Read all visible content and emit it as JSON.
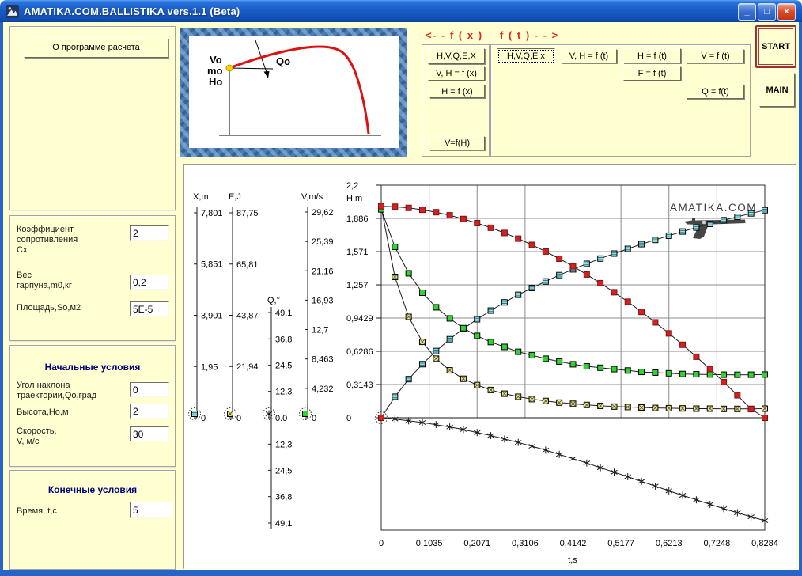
{
  "window": {
    "title": "AMATIKA.COM.BALLISTIKA vers.1.1 (Beta)",
    "minimize_glyph": "_",
    "maximize_glyph": "□",
    "close_glyph": "×"
  },
  "left": {
    "about_button": "О программе расчета",
    "params": {
      "cx_label": "Коэффициент\nсопротивления\nСх",
      "cx_value": "2",
      "m_label": "Вес\nгарпуна,m0,кг",
      "m_value": "0,2",
      "s_label": "Площадь,So,м2",
      "s_value": "5E-5"
    },
    "initial": {
      "title": "Начальные условия",
      "q_label": "Угол наклона\nтраектории,Qo,град",
      "q_value": "0",
      "h_label": "Высота,Но,м",
      "h_value": "2",
      "v_label": "Скорость,\nV, м/с",
      "v_value": "30"
    },
    "final": {
      "title": "Конечные условия",
      "t_label": "Время, t,c",
      "t_value": "5"
    }
  },
  "diagram": {
    "v_label": "Vo",
    "m_label": "mo",
    "h_label": "Ho",
    "q_label": "Qo"
  },
  "fx": {
    "title": "<- - f ( x )",
    "buttons": [
      "H,V,Q,E,X",
      "V, H = f (x)",
      "H = f (x)",
      "V=f(H)"
    ]
  },
  "ft": {
    "title": "f ( t ) - - >",
    "active_button": "H,V,Q,E x",
    "buttons": [
      "V, H = f (t)",
      "H = f (t)",
      "V = f (t)",
      "F = f (t)",
      "Q = f(t)"
    ]
  },
  "actions": {
    "start": "START",
    "main": "MAIN"
  },
  "chart_data": {
    "type": "line",
    "title_watermark": "AMATIKA.COM",
    "xlabel": "t,s",
    "x_range": [
      0,
      0.8284
    ],
    "x_tick_labels": [
      "0",
      "0,1035",
      "0,2071",
      "0,3106",
      "0,4142",
      "0,5177",
      "0,6213",
      "0,7248",
      "0,8284"
    ],
    "grid": true,
    "x": [
      0,
      0.0296,
      0.0592,
      0.0888,
      0.1184,
      0.148,
      0.1775,
      0.2071,
      0.2367,
      0.2663,
      0.2959,
      0.3255,
      0.3551,
      0.3846,
      0.4142,
      0.4438,
      0.4734,
      0.503,
      0.5325,
      0.5621,
      0.5917,
      0.6213,
      0.6509,
      0.6805,
      0.7101,
      0.7397,
      0.7692,
      0.7988,
      0.8284
    ],
    "series": [
      {
        "id": "X",
        "label": "X,m",
        "marker": "square-stripe",
        "color": "#96dbde",
        "axis_max": 7.801,
        "tick_labels": [
          "7,801",
          "5,851",
          "3,901",
          "1,95",
          "0"
        ],
        "tick_values": [
          7.801,
          5.851,
          3.901,
          1.95,
          0
        ],
        "values": [
          0,
          0.8,
          1.47,
          2.04,
          2.54,
          2.99,
          3.39,
          3.75,
          4.08,
          4.39,
          4.68,
          4.94,
          5.19,
          5.43,
          5.65,
          5.86,
          6.06,
          6.25,
          6.43,
          6.61,
          6.77,
          6.93,
          7.09,
          7.24,
          7.38,
          7.52,
          7.65,
          7.78,
          7.9
        ]
      },
      {
        "id": "E",
        "label": "E,J",
        "marker": "square-x",
        "color": "#f0e878",
        "axis_max": 87.75,
        "tick_labels": [
          "87,75",
          "65,81",
          "43,87",
          "21,94",
          "0"
        ],
        "tick_values": [
          87.75,
          65.81,
          43.87,
          21.94,
          0
        ],
        "values": [
          90,
          60.3,
          43.2,
          32.5,
          25.3,
          20.3,
          16.7,
          14,
          11.9,
          10.3,
          9,
          8,
          7.2,
          6.5,
          6,
          5.5,
          5.1,
          4.8,
          4.6,
          4.4,
          4.2,
          4.1,
          4,
          3.9,
          3.9,
          3.8,
          3.8,
          3.8,
          3.9
        ]
      },
      {
        "id": "Q",
        "label": "Q,°",
        "marker": "star",
        "color": "#111111",
        "axis_max": 49.1,
        "tick_labels": [
          "49,1",
          "36,8",
          "24,5",
          "12,3",
          "0.0",
          "12,3",
          "24,5",
          "36,8",
          "49,1"
        ],
        "tick_values": [
          49.1,
          36.8,
          24.5,
          12.3,
          0,
          -12.3,
          -24.5,
          -36.8,
          -49.1
        ],
        "values": [
          0,
          -0.6,
          -1.4,
          -2.2,
          -3.2,
          -4.3,
          -5.5,
          -6.9,
          -8.3,
          -9.9,
          -11.5,
          -13.3,
          -15.1,
          -17.1,
          -19.1,
          -21.1,
          -23.3,
          -25.4,
          -27.5,
          -29.7,
          -31.9,
          -34.1,
          -36.2,
          -38.3,
          -40.4,
          -42.4,
          -44.3,
          -46.2,
          -48
        ]
      },
      {
        "id": "V",
        "label": "V,m/s",
        "marker": "square",
        "color": "#2fd42f",
        "axis_max": 29.62,
        "tick_labels": [
          "29,62",
          "25,39",
          "21,16",
          "16,93",
          "12,7",
          "8,463",
          "4,232",
          "0"
        ],
        "tick_values": [
          29.62,
          25.39,
          21.16,
          16.93,
          12.7,
          8.463,
          4.232,
          0
        ],
        "values": [
          30,
          24.6,
          20.8,
          18,
          15.9,
          14.3,
          12.9,
          11.8,
          10.9,
          10.2,
          9.5,
          9,
          8.5,
          8.1,
          7.7,
          7.4,
          7.2,
          7,
          6.8,
          6.6,
          6.5,
          6.4,
          6.3,
          6.26,
          6.23,
          6.2,
          6.19,
          6.2,
          6.22
        ]
      },
      {
        "id": "H",
        "label": "H,m",
        "marker": "square",
        "color": "#d42020",
        "axis_max": 2.2,
        "tick_labels": [
          "2,2",
          "1,886",
          "1,571",
          "1,257",
          "0,9429",
          "0,6286",
          "0,3143",
          "0"
        ],
        "tick_values": [
          2.2,
          1.886,
          1.571,
          1.257,
          0.9429,
          0.6286,
          0.3143,
          0
        ],
        "values": [
          2,
          1.996,
          1.985,
          1.967,
          1.944,
          1.915,
          1.88,
          1.841,
          1.797,
          1.748,
          1.694,
          1.635,
          1.572,
          1.504,
          1.432,
          1.355,
          1.273,
          1.187,
          1.097,
          1.001,
          0.902,
          0.798,
          0.69,
          0.577,
          0.46,
          0.338,
          0.213,
          0.082,
          0
        ]
      }
    ]
  }
}
